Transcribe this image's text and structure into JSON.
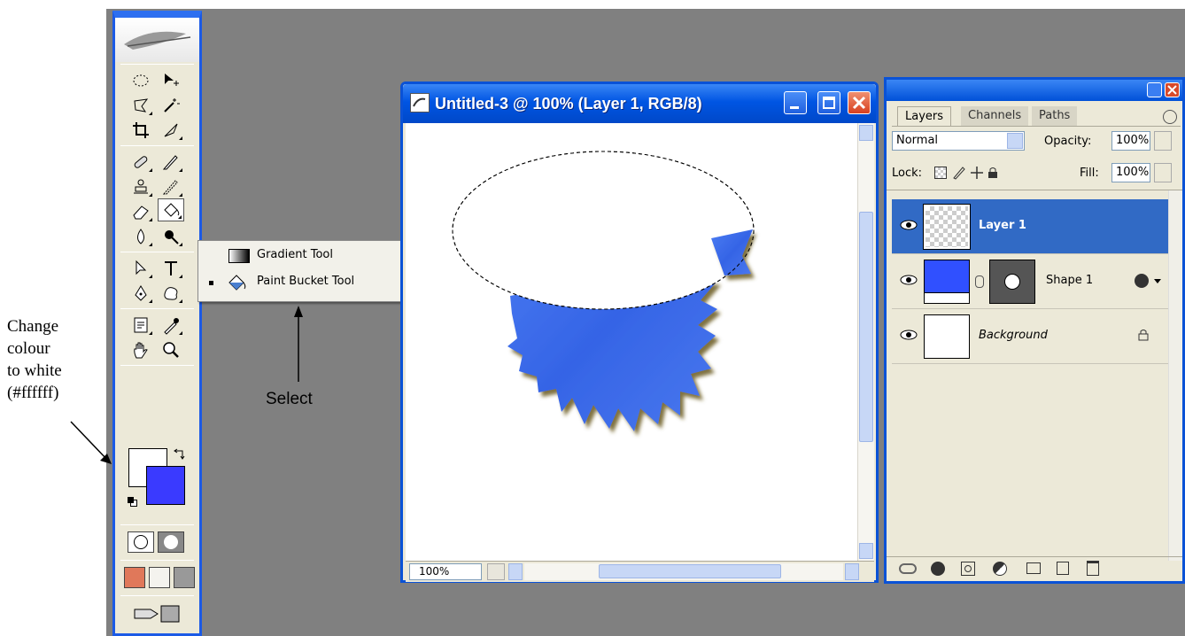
{
  "annotations": {
    "change_colour": [
      "Change",
      "colour",
      "to white",
      "(#ffffff)"
    ],
    "select": "Select"
  },
  "toolbox": {
    "foreground_color": "#ffffff",
    "background_color": "#3a3aff"
  },
  "flyout": {
    "items": [
      {
        "label": "Gradient Tool",
        "key": "G",
        "selected": false
      },
      {
        "label": "Paint Bucket Tool",
        "key": "G",
        "selected": true
      }
    ]
  },
  "document": {
    "title": "Untitled-3 @ 100% (Layer 1, RGB/8)",
    "zoom": "100%",
    "shape_color": "#3b6ef0"
  },
  "layers_panel": {
    "tabs": [
      "Layers",
      "Channels",
      "Paths"
    ],
    "active_tab": "Layers",
    "blend_mode": "Normal",
    "opacity_label": "Opacity:",
    "opacity": "100%",
    "lock_label": "Lock:",
    "fill_label": "Fill:",
    "fill": "100%",
    "layers": [
      {
        "name": "Layer 1",
        "selected": true
      },
      {
        "name": "Shape 1",
        "selected": false
      },
      {
        "name": "Background",
        "selected": false
      }
    ]
  }
}
